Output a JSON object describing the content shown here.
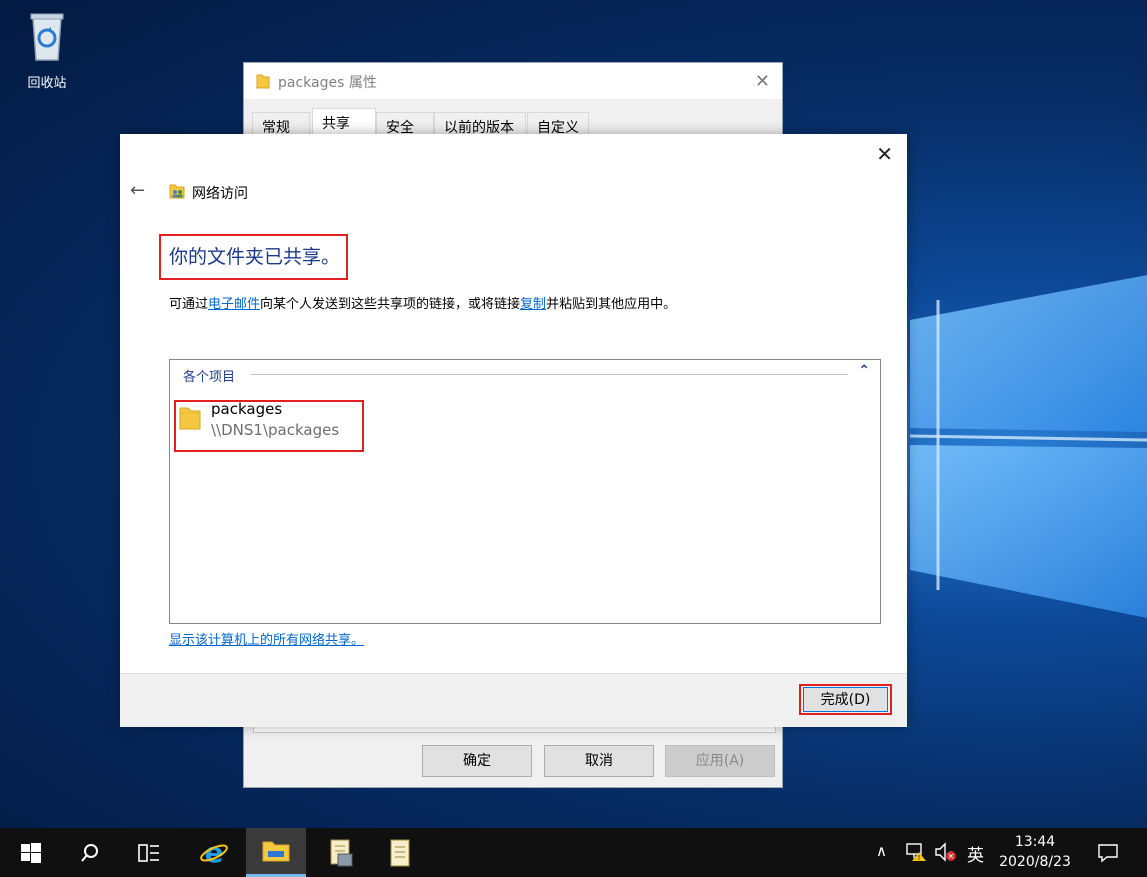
{
  "desktop": {
    "recycle_bin_label": "回收站"
  },
  "properties_dialog": {
    "title": "packages 属性",
    "tabs": [
      {
        "label": "常规"
      },
      {
        "label": "共享",
        "active": true
      },
      {
        "label": "安全"
      },
      {
        "label": "以前的版本"
      },
      {
        "label": "自定义"
      }
    ],
    "buttons": {
      "ok": "确定",
      "cancel": "取消",
      "apply": "应用(A)"
    }
  },
  "sharing_wizard": {
    "header_title": "网络访问",
    "heading": "你的文件夹已共享。",
    "description": {
      "prefix": "可通过",
      "email_link": "电子邮件",
      "middle": "向某个人发送到这些共享项的链接，或将链接",
      "copy_link": "复制",
      "suffix": "并粘贴到其他应用中。"
    },
    "group_label": "各个项目",
    "items": [
      {
        "name": "packages",
        "path": "\\\\DNS1\\packages"
      }
    ],
    "show_all_shares_link": "显示该计算机上的所有网络共享。",
    "finish_button": "完成(D)"
  },
  "taskbar": {
    "input_language": "英",
    "time": "13:44",
    "date": "2020/8/23"
  },
  "colors": {
    "highlight_red": "#e02020",
    "link_blue": "#0066cc",
    "heading_blue": "#1b3a8c",
    "taskbar_bg": "#101010"
  }
}
